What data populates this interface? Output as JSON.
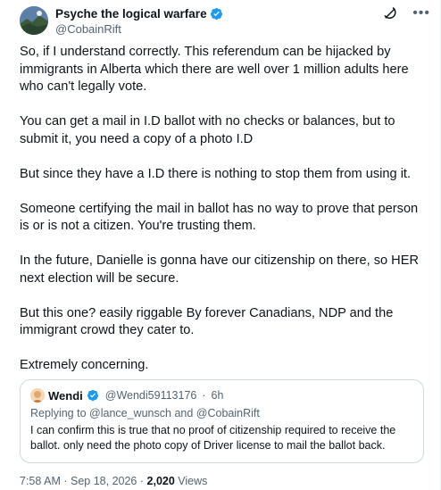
{
  "author": {
    "name": "Psyche the logical warfare",
    "handle": "@CobainRift"
  },
  "icons": {
    "verified": "verified-badge-icon",
    "grok": "grok-icon",
    "more": "more-options-icon"
  },
  "colors": {
    "verified": "#1d9bf0",
    "muted_text": "#536471",
    "border": "#cfd9de"
  },
  "post": {
    "paragraphs": [
      "So, if I understand correctly. This referendum can be hijacked by immigrants in Alberta which there are well over 1 million adults here who can't legally vote.",
      "You can get a mail in I.D ballot with no checks or balances, but to submit it, you need a copy of a photo I.D",
      "But since they have a I.D there is nothing to stop them from using it.",
      "Someone certifying the mail in ballot has no way to prove that person is or is not a citizen. You're trusting them.",
      "In the future, Danielle is gonna have our citizenship on there, so HER next election will be secure.",
      "But this one? easily riggable By forever Canadians, NDP and the immigrant crowd they cater to.",
      "Extremely concerning."
    ]
  },
  "quote": {
    "name": "Wendi",
    "handle": "@Wendi59113176",
    "separator": "·",
    "time": "6h",
    "replying_prefix": "Replying to",
    "mention_1": "@lance_wunsch",
    "and": "and",
    "mention_2": "@CobainRift",
    "text": "I can confirm this is true that no proof of citizenship required to receive the ballot. only need the photo copy of Driver license to mail the ballot back."
  },
  "footer": {
    "time": "7:58 AM",
    "dot": "·",
    "date": "Sep 18, 2026",
    "dot2": "·",
    "views_count": "2,020",
    "views_label": "Views"
  }
}
